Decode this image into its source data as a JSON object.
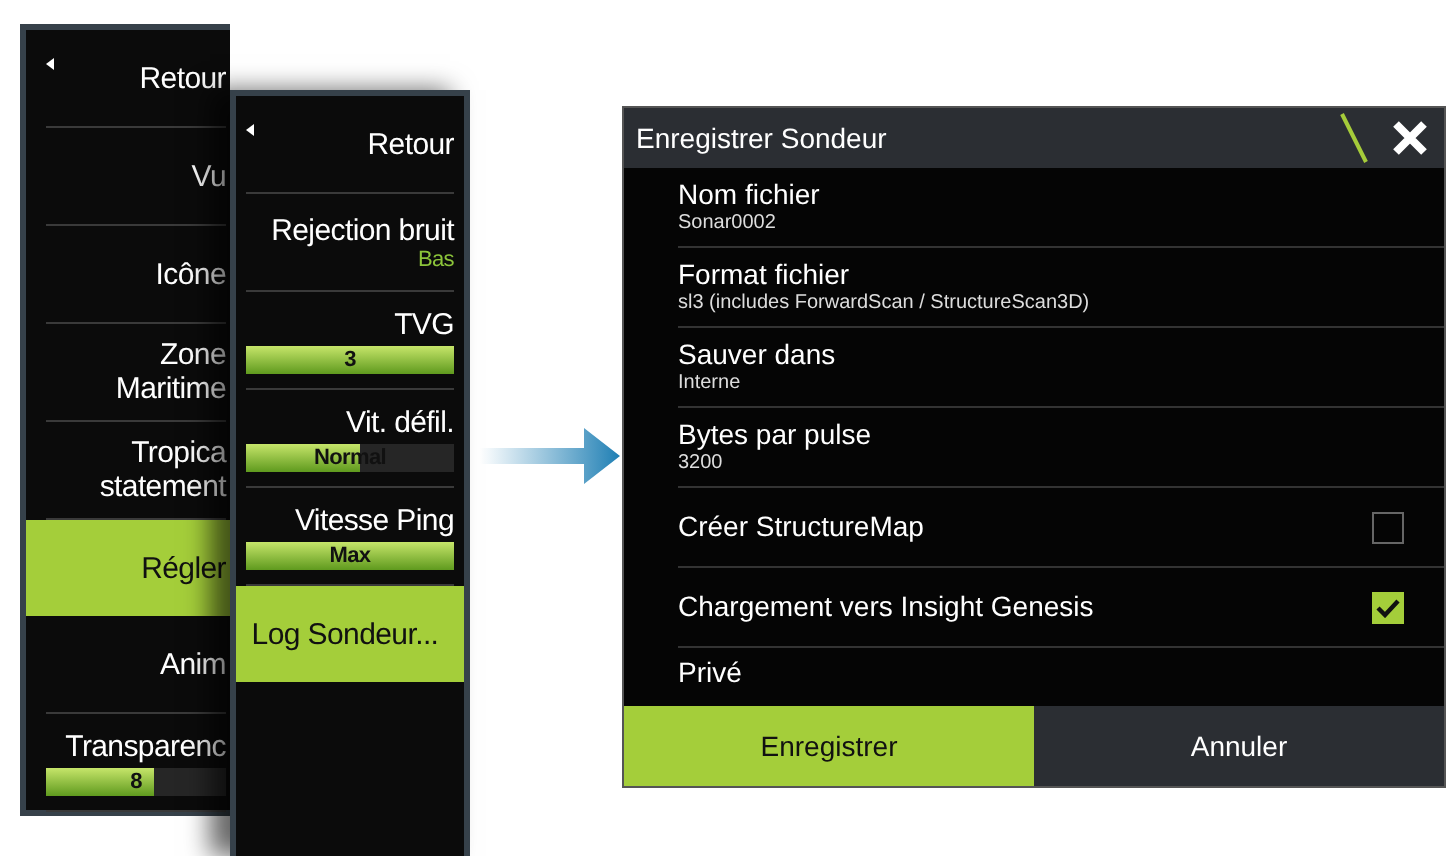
{
  "left_menu": {
    "items": [
      {
        "kind": "back",
        "lines": [
          "Retour"
        ],
        "selected": false
      },
      {
        "kind": "item",
        "lines": [
          "Vu"
        ],
        "selected": false
      },
      {
        "kind": "item",
        "lines": [
          "Icône"
        ],
        "selected": false
      },
      {
        "kind": "item",
        "lines": [
          "Zone",
          "Maritime"
        ],
        "selected": false
      },
      {
        "kind": "item",
        "lines": [
          "Tropica",
          "statement"
        ],
        "selected": false
      },
      {
        "kind": "item",
        "lines": [
          "Régler"
        ],
        "selected": true
      },
      {
        "kind": "item",
        "lines": [
          "Anim"
        ],
        "selected": false
      },
      {
        "kind": "slider",
        "lines": [
          "Transparenc"
        ],
        "value": "8",
        "level": 0.6,
        "selected": false
      }
    ]
  },
  "submenu": {
    "items": [
      {
        "kind": "back",
        "lines": [
          "Retour"
        ],
        "selected": false
      },
      {
        "kind": "option",
        "lines": [
          "Rejection bruit"
        ],
        "value": "Bas",
        "selected": false
      },
      {
        "kind": "slider",
        "lines": [
          "TVG"
        ],
        "value": "3",
        "level": 1,
        "selected": false
      },
      {
        "kind": "slider",
        "lines": [
          "Vit. défil."
        ],
        "value": "Normal",
        "level": 0.55,
        "selected": false
      },
      {
        "kind": "slider",
        "lines": [
          "Vitesse Ping"
        ],
        "value": "Max",
        "level": 1,
        "selected": false
      },
      {
        "kind": "item",
        "lines": [
          "Log Sondeur..."
        ],
        "selected": true
      }
    ]
  },
  "dialog": {
    "title": "Enregistrer Sondeur",
    "rows": [
      {
        "kind": "field",
        "label": "Nom fichier",
        "value": "Sonar0002"
      },
      {
        "kind": "field",
        "label": "Format fichier",
        "value": "sl3 (includes ForwardScan / StructureScan3D)"
      },
      {
        "kind": "field",
        "label": "Sauver dans",
        "value": "Interne"
      },
      {
        "kind": "field",
        "label": "Bytes par pulse",
        "value": "3200"
      },
      {
        "kind": "checkbox",
        "label": "Créer StructureMap",
        "checked": false
      },
      {
        "kind": "checkbox",
        "label": "Chargement vers Insight Genesis",
        "checked": true
      },
      {
        "kind": "field",
        "label": "Privé"
      }
    ],
    "buttons": [
      {
        "label": "Enregistrer",
        "selected": true
      },
      {
        "label": "Annuler",
        "selected": false
      }
    ]
  }
}
